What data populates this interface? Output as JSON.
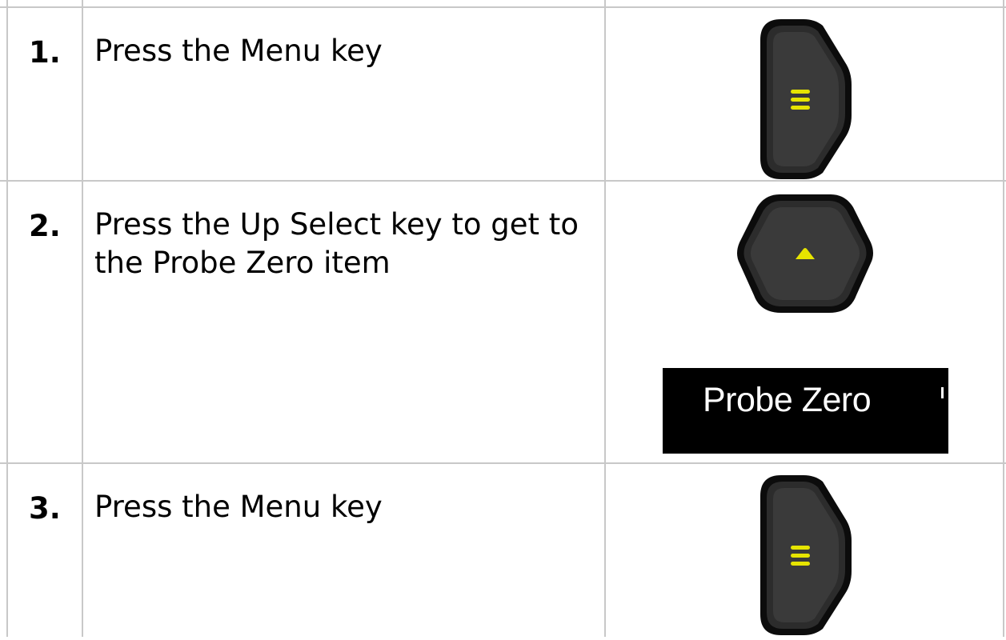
{
  "steps": [
    {
      "number": "1.",
      "text": "Press the Menu key",
      "key_icon": "menu-key-icon"
    },
    {
      "number": "2.",
      "text": "Press the Up Select key to get to the Probe Zero item",
      "key_icon": "up-select-key-icon",
      "display_label": "Probe Zero"
    },
    {
      "number": "3.",
      "text": "Press the Menu key",
      "key_icon": "menu-key-icon"
    }
  ],
  "colors": {
    "grid_lines": "#c8c8c8",
    "key_body": "#2a2a2a",
    "key_symbol": "#e6e400",
    "display_background": "#000000",
    "display_text": "#ffffff"
  }
}
